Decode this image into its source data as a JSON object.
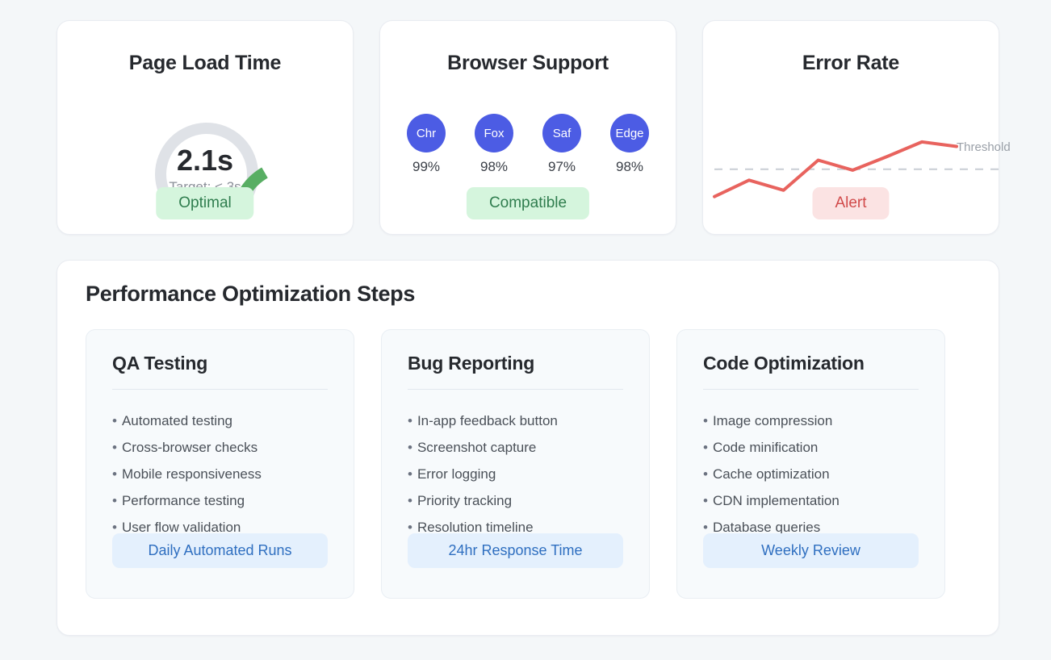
{
  "metrics": [
    {
      "title": "Page Load Time",
      "type": "gauge",
      "value": "2.1s",
      "target": "Target: < 3s",
      "badge": "Optimal",
      "badge_style": "optimal",
      "gauge": {
        "track_color": "#dfe2e7",
        "progress_color": "#58ae63",
        "value_seconds": 2.1,
        "target_seconds": 3
      }
    },
    {
      "title": "Browser Support",
      "type": "browsers",
      "badge": "Compatible",
      "badge_style": "compatible",
      "dot_color": "#4c5ce4",
      "browsers": [
        {
          "label": "Chr",
          "percent": "99%"
        },
        {
          "label": "Fox",
          "percent": "98%"
        },
        {
          "label": "Saf",
          "percent": "97%"
        },
        {
          "label": "Edge",
          "percent": "98%"
        }
      ]
    },
    {
      "title": "Error Rate",
      "type": "linechart",
      "badge": "Alert",
      "badge_style": "alert",
      "threshold_label": "Threshold"
    }
  ],
  "chart_data": {
    "type": "line",
    "title": "Error Rate",
    "xlabel": "",
    "ylabel": "",
    "grid": false,
    "legend": false,
    "line_color": "#e8635e",
    "threshold_color": "#c8cdd4",
    "series": [
      {
        "name": "Error Rate",
        "points": [
          {
            "x": 0,
            "y": 18
          },
          {
            "x": 1,
            "y": 36
          },
          {
            "x": 2,
            "y": 25
          },
          {
            "x": 3,
            "y": 58
          },
          {
            "x": 4,
            "y": 47
          },
          {
            "x": 5,
            "y": 62
          },
          {
            "x": 6,
            "y": 78
          },
          {
            "x": 7,
            "y": 73
          }
        ]
      }
    ],
    "threshold": {
      "value": 48,
      "label": "Threshold",
      "style": "dashed"
    },
    "ylim": [
      0,
      100
    ],
    "xlim": [
      0,
      7
    ]
  },
  "steps_panel": {
    "title": "Performance Optimization Steps",
    "cards": [
      {
        "title": "QA Testing",
        "items": [
          "Automated testing",
          "Cross-browser checks",
          "Mobile responsiveness",
          "Performance testing",
          "User flow validation"
        ],
        "cta": "Daily Automated Runs"
      },
      {
        "title": "Bug Reporting",
        "items": [
          "In-app feedback button",
          "Screenshot capture",
          "Error logging",
          "Priority tracking",
          "Resolution timeline"
        ],
        "cta": "24hr Response Time"
      },
      {
        "title": "Code Optimization",
        "items": [
          "Image compression",
          "Code minification",
          "Cache optimization",
          "CDN implementation",
          "Database queries"
        ],
        "cta": "Weekly Review"
      }
    ]
  }
}
